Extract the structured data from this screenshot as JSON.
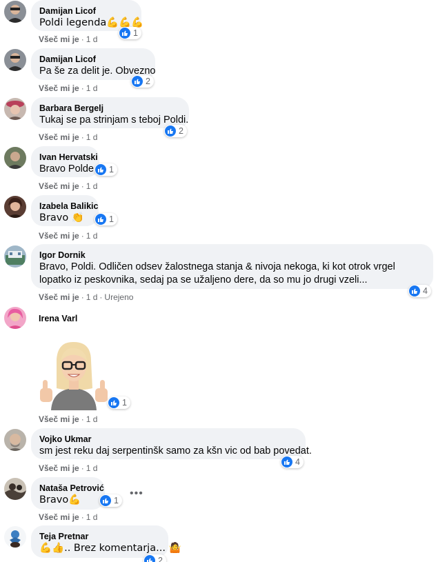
{
  "ui": {
    "like_label": "Všeč mi je",
    "separator": "·",
    "accent_color": "#1877f2",
    "bubble_color": "#f0f2f5",
    "meta_color": "#65676b"
  },
  "comments": [
    {
      "author": "Damijan Licof",
      "text": "Poldi legenda💪💪💪",
      "reactions": "1",
      "time": "1 d"
    },
    {
      "author": "Damijan Licof",
      "text": "Pa še za delit je. Obvezno",
      "reactions": "2",
      "time": "1 d"
    },
    {
      "author": "Barbara Bergelj",
      "text": "Tukaj se pa strinjam s teboj Poldi.",
      "reactions": "2",
      "time": "1 d"
    },
    {
      "author": "Ivan Hervatski",
      "text": "Bravo Polde",
      "reactions": "1",
      "time": "1 d"
    },
    {
      "author": "Izabela Balikic",
      "text": "Bravo 👏",
      "reactions": "1",
      "time": "1 d"
    },
    {
      "author": "Igor Dornik",
      "text": "Bravo, Poldi. Odličen odsev žalostnega stanja & nivoja nekoga, ki kot otrok vrgel lopatko iz peskovnika, sedaj pa se užaljeno dere, da so mu jo drugi vzeli...",
      "reactions": "4",
      "time": "1 d",
      "edited": "Urejeno"
    },
    {
      "author": "Irena Varl",
      "sticker": "avatar-thumbs-up-sticker",
      "reactions": "1",
      "time": "1 d"
    },
    {
      "author": "Vojko Ukmar",
      "text": "sm jest reku daj serpentinšk samo za kšn vic od bab povedat.",
      "reactions": "4",
      "time": "1 d"
    },
    {
      "author": "Nataša Petrović",
      "text": "Bravo💪",
      "reactions": "1",
      "time": "1 d"
    },
    {
      "author": "Teja Pretnar",
      "text": "💪👍.. Brez komentarja... 🤷",
      "reactions": "2"
    }
  ]
}
